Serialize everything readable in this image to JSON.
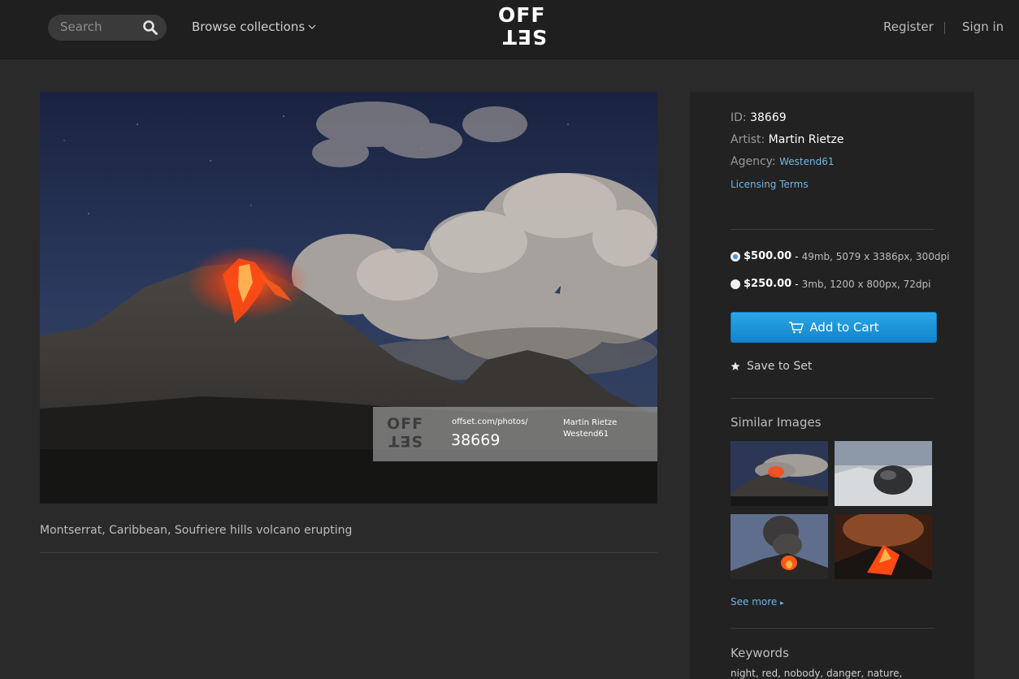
{
  "header": {
    "search_placeholder": "Search",
    "browse_label": "Browse collections",
    "logo_top": "OFF",
    "logo_bottom": "SET",
    "register_label": "Register",
    "signin_label": "Sign in"
  },
  "photo": {
    "watermark": {
      "logo_top": "OFF",
      "logo_bottom": "SET",
      "url": "offset.com/photos/",
      "id": "38669",
      "artist": "Martin Rietze",
      "agency": "Westend61"
    },
    "caption": "Montserrat, Caribbean, Soufriere hills volcano erupting"
  },
  "details": {
    "id_label": "ID:",
    "id_value": "38669",
    "artist_label": "Artist:",
    "artist_value": "Martin Rietze",
    "agency_label": "Agency:",
    "agency_value": "Westend61",
    "licensing_label": "Licensing Terms"
  },
  "pricing": {
    "options": [
      {
        "price": "$500.00",
        "sep": "-",
        "spec": "49mb, 5079 x 3386px, 300dpi",
        "selected": true
      },
      {
        "price": "$250.00",
        "sep": "-",
        "spec": "3mb, 1200 x 800px, 72dpi",
        "selected": false
      }
    ],
    "add_to_cart": "Add to Cart",
    "save_to_set": "Save to Set"
  },
  "similar": {
    "title": "Similar Images",
    "see_more": "See more"
  },
  "keywords": {
    "title": "Keywords",
    "text": "night, red, nobody, danger, nature,"
  },
  "colors": {
    "accent": "#1e98dc",
    "link": "#6db6e8",
    "background": "#2a2a2a",
    "header": "#1f1f1f",
    "panel": "#222222"
  }
}
